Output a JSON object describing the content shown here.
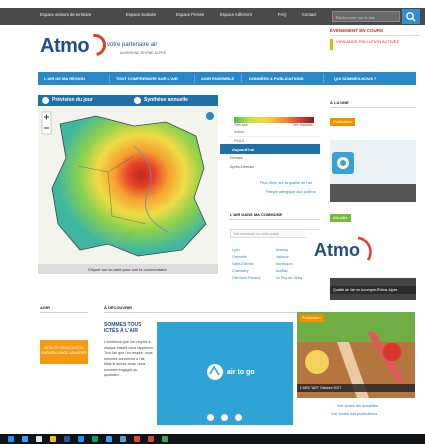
{
  "topbar": {
    "links": [
      "Espace acteurs de territoire",
      "Espace Scolaire",
      "Espace Presse",
      "Espace Adhérent",
      "FAQ",
      "Contact"
    ],
    "search_placeholder": "Rechercher sur le site"
  },
  "header": {
    "logo": "Atmo",
    "tagline": "votre partenaire air",
    "region": "AUVERGNE-RHÔNE-ALPES",
    "alert_title": "ÉVÉNEMENT EN COURS",
    "alert_text": "VIGILANCE POLLUTION ACTIVÉE"
  },
  "nav": {
    "items": [
      "L'AIR DE MA RÉGION",
      "TOUT COMPRENDRE SUR L'AIR",
      "AGIR ENSEMBLE",
      "DONNÉES & PUBLICATIONS",
      "QUI SOMMES-NOUS ?"
    ]
  },
  "map_section": {
    "tab1": "Prévision du jour",
    "tab2": "Synthèse annuelle",
    "caption": "Cliquer sur la carte pour voir le commentaire",
    "legend_min": "Très bon",
    "legend_max": "Très mauvais",
    "pollutants": [
      "Indice",
      "PM10"
    ],
    "day_active": "Aujourd'hui",
    "days": [
      "Demain",
      "Après-Demain"
    ],
    "more1": "Plus d'info sur la qualité de l'air",
    "more2": "Risque allergique aux pollens"
  },
  "commune": {
    "title": "L'AIR DANS MA COMMUNE",
    "placeholder": "Ma commune ou code postal",
    "cities_col1": [
      "Lyon",
      "Grenoble",
      "Saint-Étienne",
      "Chambéry",
      "Clermont-Ferrand"
    ],
    "cities_col2": [
      "Annecy",
      "Valence",
      "Montluçon",
      "Aurillac",
      "Le Puy-en-Velay"
    ]
  },
  "right_col": {
    "title": "À LA UNE",
    "badge1": "Publication",
    "badge2": "Actualité",
    "card2_caption": "Qualité de l'air en Auvergne-Rhône-Alpes"
  },
  "bottom": {
    "agir_title": "AGIR",
    "decouvrir_title": "À DÉCOUVRIR",
    "yellow_button": "ATOUTS ASSOCIATION SURVEILLANCE ADHÉRER",
    "sommes": "SOMMES TOUS ICTÉS À L'AIR",
    "para": "L'existence que l'on respire à chaque instant nous rappelons. Tout l'air que l'on respire, nous sommes concernés à l'air. Mais le suivez-nous, nous sommes engagés au quotidien…",
    "airtogo": "air to go",
    "news_caption": "L'ARS \"AIR\" Octobre 2017",
    "link1": "Voir toutes les actualités",
    "link2": "Voir toutes nos publications"
  },
  "colors": {
    "brand_blue": "#2a88c6",
    "dark_blue": "#1f4e8c",
    "accent_red": "#e53b2c",
    "orange": "#f39c12"
  }
}
